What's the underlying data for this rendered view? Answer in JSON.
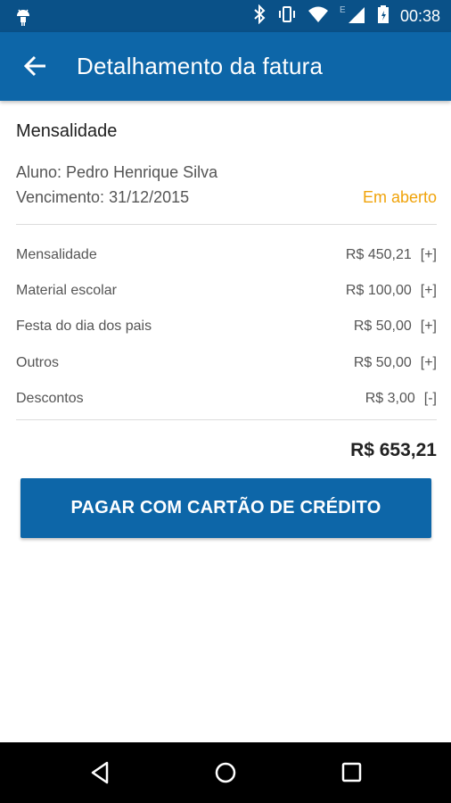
{
  "status_bar": {
    "time": "00:38",
    "icons": [
      "android-icon",
      "bluetooth-icon",
      "vibrate-icon",
      "wifi-icon",
      "signal-icon",
      "battery-icon"
    ]
  },
  "app_bar": {
    "title": "Detalhamento da fatura",
    "back_icon": "arrow-back-icon"
  },
  "invoice": {
    "section_title": "Mensalidade",
    "student": "Aluno: Pedro Henrique Silva",
    "due_date": "Vencimento: 31/12/2015",
    "status": "Em aberto",
    "status_color": "#f0a30a",
    "items": [
      {
        "label": "Mensalidade",
        "value": "R$ 450,21",
        "sign": "[+]"
      },
      {
        "label": "Material escolar",
        "value": "R$ 100,00",
        "sign": "[+]"
      },
      {
        "label": "Festa do dia dos pais",
        "value": "R$ 50,00",
        "sign": "[+]"
      },
      {
        "label": "Outros",
        "value": "R$ 50,00",
        "sign": "[+]"
      },
      {
        "label": "Descontos",
        "value": "R$ 3,00",
        "sign": "[-]"
      }
    ],
    "total": "R$ 653,21"
  },
  "actions": {
    "pay_label": "PAGAR COM CARTÃO DE CRÉDITO"
  },
  "nav_bar": {
    "icons": [
      "back-triangle-icon",
      "home-circle-icon",
      "recents-square-icon"
    ]
  },
  "colors": {
    "status_bar": "#0a5188",
    "app_bar": "#0d66a8",
    "accent": "#0d66a8"
  }
}
